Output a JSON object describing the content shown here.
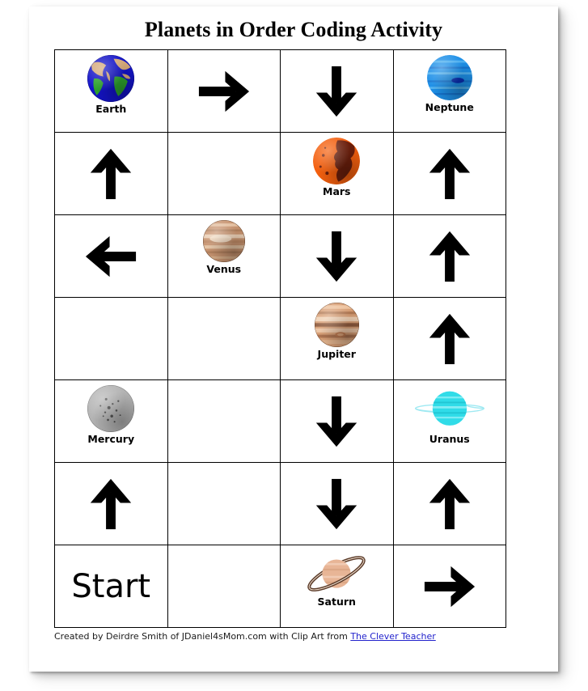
{
  "page": {
    "title": "Planets in Order Coding Activity"
  },
  "credit": {
    "prefix": "Created by Deirdre Smith of JDaniel4sMom.com with Clip Art from ",
    "link_text": "The Clever Teacher"
  },
  "grid": {
    "columns": 4,
    "rows": 7,
    "cells": [
      [
        {
          "type": "planet",
          "planet": "earth",
          "label": "Earth"
        },
        {
          "type": "arrow",
          "direction": "right"
        },
        {
          "type": "arrow",
          "direction": "down"
        },
        {
          "type": "planet",
          "planet": "neptune",
          "label": "Neptune"
        }
      ],
      [
        {
          "type": "arrow",
          "direction": "up"
        },
        {
          "type": "empty"
        },
        {
          "type": "planet",
          "planet": "mars",
          "label": "Mars"
        },
        {
          "type": "arrow",
          "direction": "up"
        }
      ],
      [
        {
          "type": "arrow",
          "direction": "left"
        },
        {
          "type": "planet",
          "planet": "venus",
          "label": "Venus"
        },
        {
          "type": "arrow",
          "direction": "down"
        },
        {
          "type": "arrow",
          "direction": "up"
        }
      ],
      [
        {
          "type": "empty"
        },
        {
          "type": "empty"
        },
        {
          "type": "planet",
          "planet": "jupiter",
          "label": "Jupiter"
        },
        {
          "type": "arrow",
          "direction": "up"
        }
      ],
      [
        {
          "type": "planet",
          "planet": "mercury",
          "label": "Mercury"
        },
        {
          "type": "empty"
        },
        {
          "type": "arrow",
          "direction": "down"
        },
        {
          "type": "planet",
          "planet": "uranus",
          "label": "Uranus"
        }
      ],
      [
        {
          "type": "arrow",
          "direction": "up"
        },
        {
          "type": "empty"
        },
        {
          "type": "arrow",
          "direction": "down"
        },
        {
          "type": "arrow",
          "direction": "up"
        }
      ],
      [
        {
          "type": "start",
          "label": "Start"
        },
        {
          "type": "empty"
        },
        {
          "type": "planet",
          "planet": "saturn",
          "label": "Saturn"
        },
        {
          "type": "arrow",
          "direction": "right"
        }
      ]
    ]
  },
  "colors": {
    "arrow": "#000000",
    "grid_line": "#000000",
    "page_background": "#ffffff",
    "title_text": "#000000",
    "label_text": "#000000",
    "link": "#2222cc",
    "earth_ocean": "#1414c8",
    "earth_land": "#2fa82f",
    "earth_desert": "#d5a878",
    "neptune": "#1e90e8",
    "neptune_spot": "#0a2fb4",
    "mars": "#f4600f",
    "mars_dark": "#6b1f0c",
    "venus": "#c89470",
    "jupiter": "#d9a077",
    "mercury": "#b4b4b4",
    "uranus": "#30dce8",
    "saturn": "#e8b596",
    "saturn_ring": "#5a3a28"
  },
  "planet_sizes": {
    "earth": 58,
    "neptune": 56,
    "mars": 58,
    "venus": 52,
    "jupiter": 55,
    "mercury": 58,
    "uranus": 46,
    "saturn": 44
  }
}
